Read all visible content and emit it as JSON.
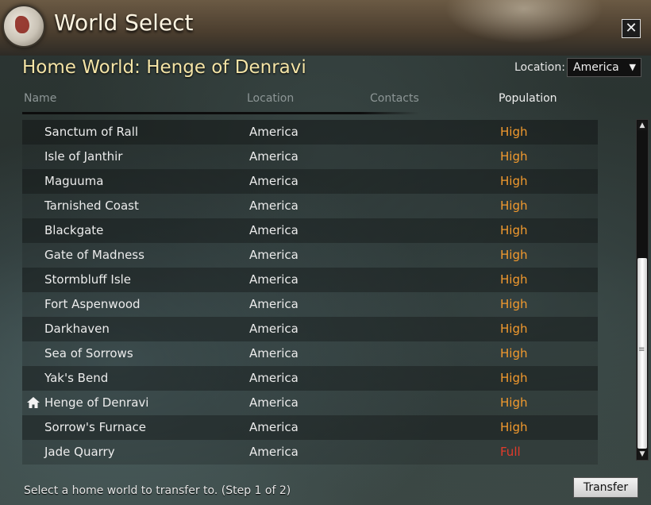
{
  "window": {
    "title": "World Select",
    "close_label": "✕"
  },
  "home_world": {
    "label": "Home World: Henge of Denravi"
  },
  "location_filter": {
    "label": "Location:",
    "selected": "America"
  },
  "columns": {
    "name": "Name",
    "location": "Location",
    "contacts": "Contacts",
    "population": "Population"
  },
  "worlds": [
    {
      "name": "Sanctum of Rall",
      "location": "America",
      "population": "High"
    },
    {
      "name": "Isle of Janthir",
      "location": "America",
      "population": "High"
    },
    {
      "name": "Maguuma",
      "location": "America",
      "population": "High"
    },
    {
      "name": "Tarnished Coast",
      "location": "America",
      "population": "High"
    },
    {
      "name": "Blackgate",
      "location": "America",
      "population": "High"
    },
    {
      "name": "Gate of Madness",
      "location": "America",
      "population": "High"
    },
    {
      "name": "Stormbluff Isle",
      "location": "America",
      "population": "High"
    },
    {
      "name": "Fort Aspenwood",
      "location": "America",
      "population": "High"
    },
    {
      "name": "Darkhaven",
      "location": "America",
      "population": "High"
    },
    {
      "name": "Sea of Sorrows",
      "location": "America",
      "population": "High"
    },
    {
      "name": "Yak's Bend",
      "location": "America",
      "population": "High"
    },
    {
      "name": "Henge of Denravi",
      "location": "America",
      "population": "High",
      "home": true
    },
    {
      "name": "Sorrow's Furnace",
      "location": "America",
      "population": "High"
    },
    {
      "name": "Jade Quarry",
      "location": "America",
      "population": "Full"
    }
  ],
  "footer": {
    "status": "Select a home world to transfer to. (Step 1 of 2)",
    "transfer_label": "Transfer"
  },
  "colors": {
    "population_high": "#f29a2e",
    "population_full": "#e23b2b",
    "home_world_text": "#f4e4a6"
  }
}
